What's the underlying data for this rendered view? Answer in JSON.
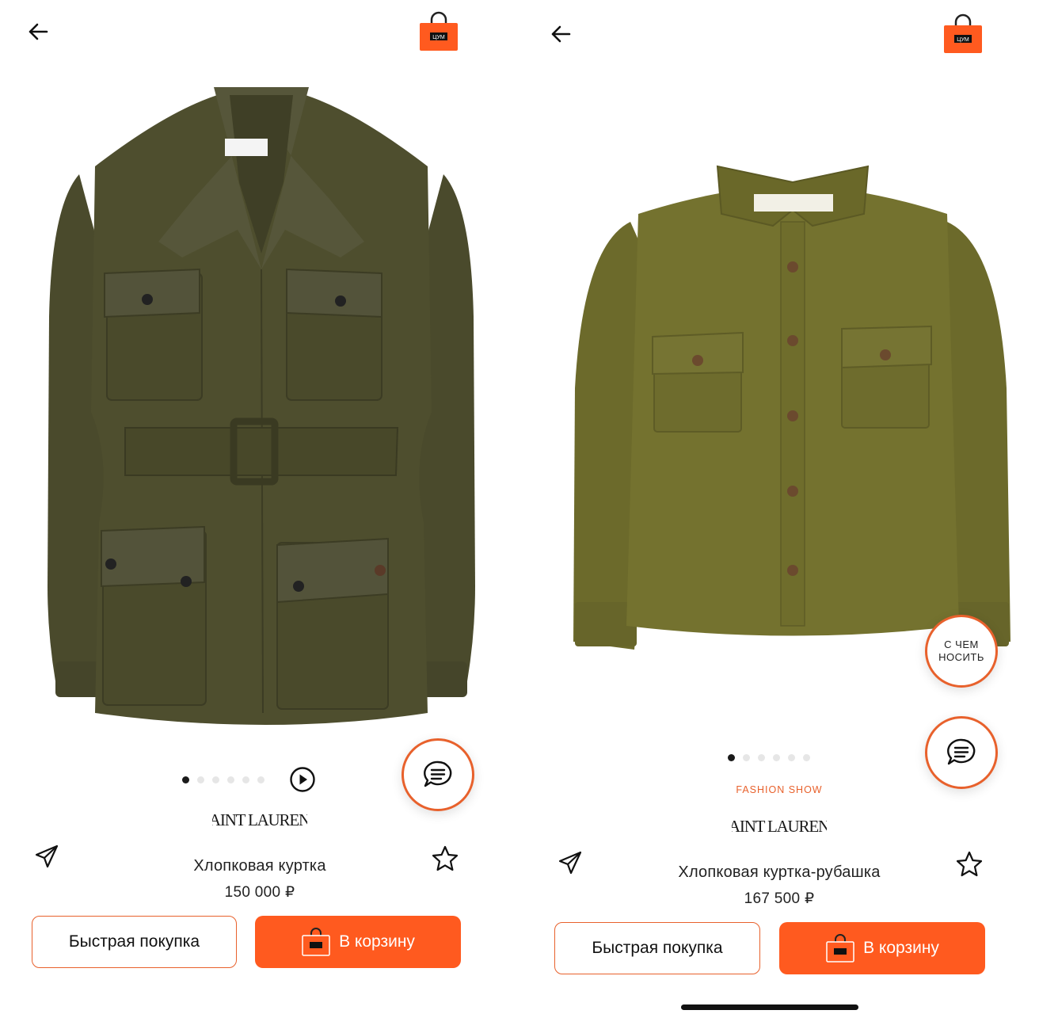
{
  "screens": [
    {
      "brand": "SAINT LAURENT",
      "product_name": "Хлопковая куртка",
      "price": "150 000 ₽",
      "quick_buy_label": "Быстрая покупка",
      "cart_label": "В корзину",
      "image_count": 6,
      "active_image": 1,
      "has_video": true,
      "product_color": "#4e4e2e"
    },
    {
      "tag": "FASHION SHOW",
      "wear_with_label_1": "С ЧЕМ",
      "wear_with_label_2": "НОСИТЬ",
      "brand": "SAINT LAURENT",
      "product_name": "Хлопковая куртка-рубашка",
      "price": "167 500 ₽",
      "quick_buy_label": "Быстрая покупка",
      "cart_label": "В корзину",
      "image_count": 6,
      "active_image": 1,
      "product_color": "#72702e"
    }
  ],
  "logo_text": "ЦУМ",
  "colors": {
    "accent": "#ff5a1f",
    "accent_border": "#e8612c",
    "text": "#1a1a1a"
  },
  "icons": [
    "back-arrow-icon",
    "shopping-bag-logo",
    "chat-icon",
    "play-icon",
    "send-icon",
    "star-icon"
  ]
}
